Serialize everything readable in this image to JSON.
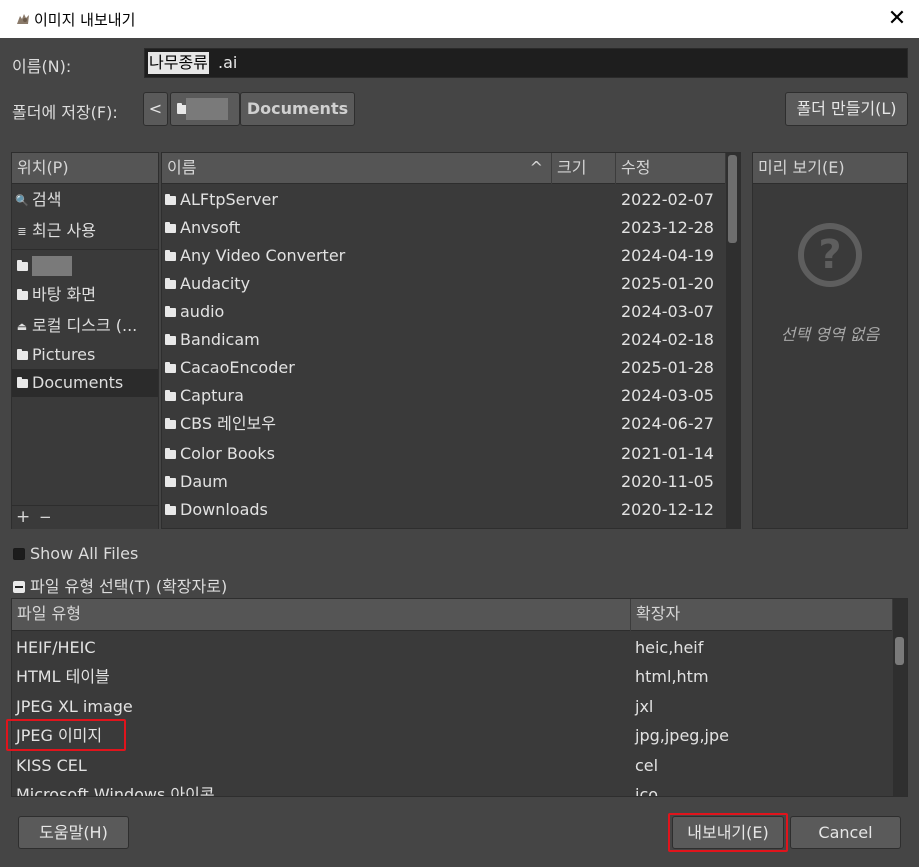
{
  "window": {
    "title": "이미지 내보내기",
    "close_glyph": "✕",
    "icon": "gimp-wilber-icon"
  },
  "name_row": {
    "label": "이름(N):",
    "value_selected": "나무종류",
    "value_rest": ".ai"
  },
  "folder_row": {
    "label": "폴더에 저장(F):",
    "back_glyph": "<",
    "current": "Documents",
    "new_folder_button": "폴더 만들기(L)"
  },
  "places": {
    "header": "위치(P)",
    "items": [
      {
        "icon": "search-icon",
        "glyph": "🔍",
        "label": "검색"
      },
      {
        "icon": "recent-icon",
        "glyph": "≣",
        "label": "최근 사용"
      },
      {
        "icon": "home-folder-icon",
        "label": ""
      },
      {
        "icon": "folder-icon",
        "label": "바탕 화면"
      },
      {
        "icon": "drive-icon",
        "glyph": "⏏",
        "label": "로컬 디스크 (..."
      },
      {
        "icon": "folder-icon",
        "label": "Pictures"
      },
      {
        "icon": "folder-icon",
        "label": "Documents"
      }
    ],
    "add_glyph": "+",
    "remove_glyph": "−"
  },
  "files": {
    "columns": {
      "name": "이름",
      "size": "크기",
      "modified": "수정",
      "sort_glyph": "^"
    },
    "rows": [
      {
        "name": "ALFtpServer",
        "date": "2022-02-07"
      },
      {
        "name": "Anvsoft",
        "date": "2023-12-28"
      },
      {
        "name": "Any Video Converter",
        "date": "2024-04-19"
      },
      {
        "name": "Audacity",
        "date": "2025-01-20"
      },
      {
        "name": "audio",
        "date": "2024-03-07"
      },
      {
        "name": "Bandicam",
        "date": "2024-02-18"
      },
      {
        "name": "CacaoEncoder",
        "date": "2025-01-28"
      },
      {
        "name": "Captura",
        "date": "2024-03-05"
      },
      {
        "name": "CBS 레인보우",
        "date": "2024-06-27"
      },
      {
        "name": "Color Books",
        "date": "2021-01-14"
      },
      {
        "name": "Daum",
        "date": "2020-11-05"
      },
      {
        "name": "Downloads",
        "date": "2020-12-12"
      }
    ]
  },
  "preview": {
    "header": "미리 보기(E)",
    "glyph": "?",
    "empty_text": "선택 영역 없음"
  },
  "options": {
    "show_all_files": "Show All Files",
    "file_type_expander": "파일 유형 선택(T) (확장자로)"
  },
  "types": {
    "columns": {
      "type": "파일 유형",
      "ext": "확장자"
    },
    "rows": [
      {
        "type": "HEIF/HEIC",
        "ext": "heic,heif"
      },
      {
        "type": "HTML 테이블",
        "ext": "html,htm"
      },
      {
        "type": "JPEG XL image",
        "ext": "jxl"
      },
      {
        "type": "JPEG 이미지",
        "ext": "jpg,jpeg,jpe"
      },
      {
        "type": "KISS CEL",
        "ext": "cel"
      },
      {
        "type": "Microsoft Windows 아이콘",
        "ext": "ico"
      }
    ]
  },
  "buttons": {
    "help": "도움말(H)",
    "export": "내보내기(E)",
    "cancel": "Cancel"
  },
  "colors": {
    "highlight": "#e0141c",
    "dialog_bg": "#454545"
  }
}
